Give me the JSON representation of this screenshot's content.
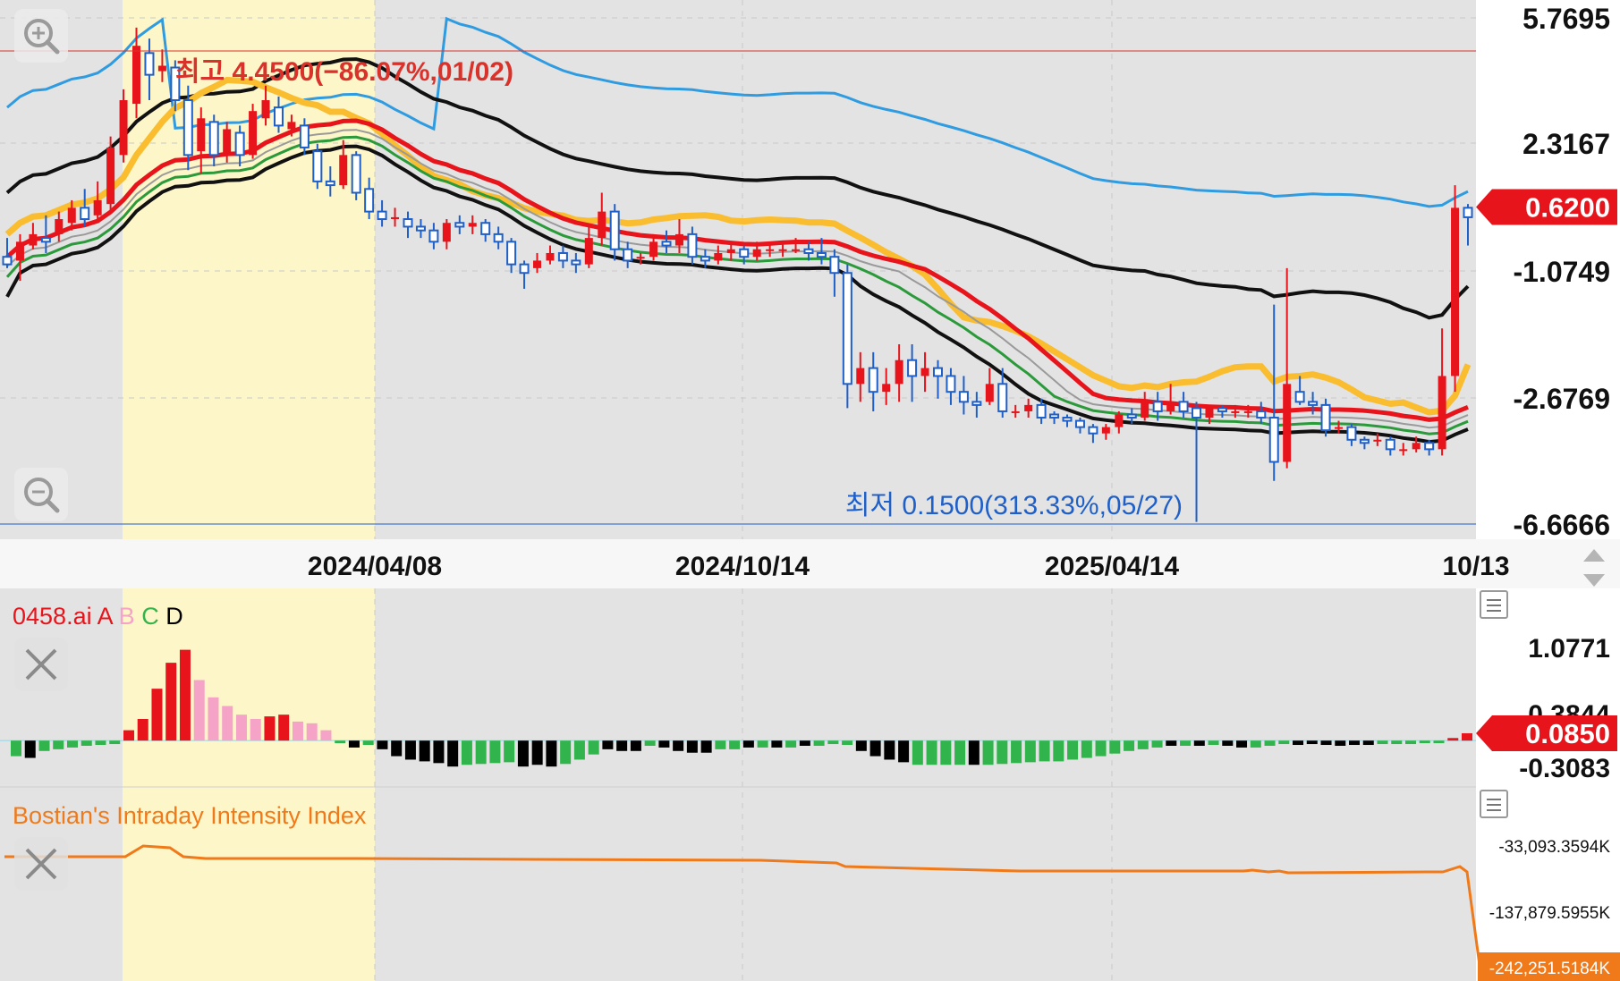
{
  "chart_data": [
    {
      "type": "candlestick",
      "title": "",
      "y_axis": {
        "ticks": [
          "5.7695",
          "2.3167",
          "-1.0749",
          "-2.6769",
          "-6.6666"
        ],
        "ylim": [
          -6.6666,
          5.7695
        ]
      },
      "x_axis": {
        "ticks": [
          "2024/04/08",
          "2024/10/14",
          "2025/04/14",
          "10/13"
        ]
      },
      "current_price": "0.6200",
      "highest_label": "최고 4.4500(−86.07%,01/02)",
      "lowest_label": "최저 0.1500(313.33%,05/27)",
      "highlight_band": "2024-01 to 2024-04",
      "ohlc": [
        [
          -0.7,
          -0.9,
          -0.2,
          -1.0
        ],
        [
          -0.8,
          -0.3,
          -0.1,
          -1.2
        ],
        [
          -0.4,
          -0.1,
          0.2,
          -0.5
        ],
        [
          -0.2,
          -0.3,
          0.4,
          -0.6
        ],
        [
          -0.1,
          0.3,
          0.5,
          -0.3
        ],
        [
          0.2,
          0.6,
          0.8,
          0.0
        ],
        [
          0.6,
          0.3,
          1.1,
          0.1
        ],
        [
          0.4,
          0.8,
          1.3,
          0.2
        ],
        [
          0.7,
          2.2,
          2.5,
          0.5
        ],
        [
          2.0,
          3.5,
          3.8,
          1.8
        ],
        [
          3.4,
          5.0,
          5.5,
          3.0
        ],
        [
          4.8,
          4.2,
          5.2,
          3.5
        ],
        [
          4.3,
          4.45,
          4.9,
          4.0
        ],
        [
          4.4,
          3.5,
          4.6,
          3.2
        ],
        [
          3.5,
          2.0,
          3.9,
          1.6
        ],
        [
          2.1,
          3.0,
          3.3,
          1.5
        ],
        [
          2.9,
          2.0,
          3.1,
          1.7
        ],
        [
          2.0,
          2.7,
          2.9,
          1.8
        ],
        [
          2.6,
          2.0,
          2.8,
          1.7
        ],
        [
          2.0,
          3.2,
          3.4,
          1.9
        ],
        [
          3.0,
          3.5,
          3.9,
          2.8
        ],
        [
          3.3,
          2.8,
          3.6,
          2.6
        ],
        [
          2.7,
          2.9,
          3.1,
          2.5
        ],
        [
          2.8,
          2.2,
          3.0,
          2.0
        ],
        [
          2.1,
          1.3,
          2.3,
          1.1
        ],
        [
          1.3,
          1.2,
          1.7,
          0.9
        ],
        [
          1.2,
          2.0,
          2.4,
          1.1
        ],
        [
          2.0,
          1.0,
          2.1,
          0.8
        ],
        [
          1.1,
          0.5,
          1.4,
          0.3
        ],
        [
          0.5,
          0.3,
          0.8,
          0.1
        ],
        [
          0.3,
          0.35,
          0.6,
          0.1
        ],
        [
          0.3,
          0.1,
          0.5,
          -0.2
        ],
        [
          0.1,
          0.0,
          0.3,
          -0.2
        ],
        [
          0.0,
          -0.3,
          0.2,
          -0.5
        ],
        [
          -0.3,
          0.2,
          0.3,
          -0.5
        ],
        [
          0.2,
          0.1,
          0.4,
          -0.1
        ],
        [
          0.1,
          0.2,
          0.4,
          -0.1
        ],
        [
          0.2,
          -0.1,
          0.3,
          -0.3
        ],
        [
          -0.1,
          -0.3,
          0.1,
          -0.5
        ],
        [
          -0.3,
          -0.9,
          -0.2,
          -1.1
        ],
        [
          -0.9,
          -1.1,
          -0.8,
          -1.3
        ],
        [
          -1.0,
          -0.8,
          -0.6,
          -1.1
        ],
        [
          -0.8,
          -0.6,
          -0.4,
          -0.9
        ],
        [
          -0.6,
          -0.8,
          -0.4,
          -1.0
        ],
        [
          -0.8,
          -0.9,
          -0.6,
          -1.1
        ],
        [
          -0.9,
          -0.2,
          0.1,
          -1.0
        ],
        [
          -0.2,
          0.5,
          1.0,
          -0.4
        ],
        [
          0.5,
          -0.5,
          0.7,
          -0.8
        ],
        [
          -0.5,
          -0.8,
          -0.3,
          -1.0
        ],
        [
          -0.7,
          -0.7,
          -0.6,
          -0.9
        ],
        [
          -0.7,
          -0.3,
          -0.1,
          -0.8
        ],
        [
          -0.3,
          -0.4,
          0.0,
          -0.6
        ],
        [
          -0.4,
          -0.1,
          0.3,
          -0.6
        ],
        [
          -0.1,
          -0.7,
          0.1,
          -0.9
        ],
        [
          -0.7,
          -0.8,
          -0.5,
          -1.0
        ],
        [
          -0.8,
          -0.6,
          -0.4,
          -0.9
        ],
        [
          -0.6,
          -0.5,
          -0.3,
          -0.8
        ],
        [
          -0.5,
          -0.7,
          -0.4,
          -0.9
        ],
        [
          -0.7,
          -0.5,
          -0.3,
          -0.8
        ],
        [
          -0.5,
          -0.5,
          -0.3,
          -0.7
        ],
        [
          -0.5,
          -0.5,
          -0.3,
          -0.7
        ],
        [
          -0.5,
          -0.5,
          -0.2,
          -0.6
        ],
        [
          -0.5,
          -0.6,
          -0.3,
          -0.8
        ],
        [
          -0.6,
          -0.7,
          -0.2,
          -0.9
        ],
        [
          -0.7,
          -1.1,
          -0.5,
          -1.4
        ],
        [
          -1.1,
          -2.5,
          -0.9,
          -3.0
        ],
        [
          -2.5,
          -2.3,
          -2.1,
          -2.8
        ],
        [
          -2.3,
          -2.6,
          -2.1,
          -3.1
        ],
        [
          -2.6,
          -2.5,
          -2.3,
          -2.9
        ],
        [
          -2.5,
          -2.2,
          -2.0,
          -2.8
        ],
        [
          -2.2,
          -2.4,
          -2.0,
          -2.8
        ],
        [
          -2.4,
          -2.3,
          -2.1,
          -2.6
        ],
        [
          -2.3,
          -2.4,
          -2.2,
          -2.7
        ],
        [
          -2.4,
          -2.6,
          -2.3,
          -2.9
        ],
        [
          -2.6,
          -2.8,
          -2.4,
          -3.2
        ],
        [
          -2.8,
          -2.9,
          -2.6,
          -3.3
        ],
        [
          -2.8,
          -2.5,
          -2.3,
          -2.9
        ],
        [
          -2.5,
          -3.1,
          -2.3,
          -3.3
        ],
        [
          -3.1,
          -3.1,
          -2.9,
          -3.3
        ],
        [
          -3.1,
          -2.9,
          -2.7,
          -3.3
        ],
        [
          -2.9,
          -3.3,
          -2.7,
          -3.5
        ],
        [
          -3.2,
          -3.3,
          -3.1,
          -3.5
        ],
        [
          -3.3,
          -3.4,
          -3.2,
          -3.6
        ],
        [
          -3.4,
          -3.6,
          -3.3,
          -3.8
        ],
        [
          -3.6,
          -3.8,
          -3.5,
          -4.1
        ],
        [
          -3.8,
          -3.6,
          -3.5,
          -4.0
        ],
        [
          -3.6,
          -3.2,
          -3.1,
          -3.8
        ],
        [
          -3.2,
          -3.3,
          -3.0,
          -3.5
        ],
        [
          -3.3,
          -2.8,
          -2.6,
          -3.4
        ],
        [
          -2.8,
          -3.1,
          -2.6,
          -3.4
        ],
        [
          -3.1,
          -2.9,
          -2.5,
          -3.2
        ],
        [
          -2.8,
          -3.1,
          -2.6,
          -3.3
        ],
        [
          -3.0,
          -3.3,
          -2.8,
          -6.6
        ],
        [
          -3.3,
          -3.0,
          -2.9,
          -3.5
        ],
        [
          -3.0,
          -3.1,
          -2.9,
          -3.3
        ],
        [
          -3.1,
          -3.1,
          -2.9,
          -3.3
        ],
        [
          -3.1,
          -3.1,
          -2.9,
          -3.3
        ],
        [
          -3.1,
          -3.3,
          -2.8,
          -3.5
        ],
        [
          -3.3,
          -4.7,
          -1.5,
          -5.3
        ],
        [
          -4.7,
          -2.5,
          -1.0,
          -4.9
        ],
        [
          -2.6,
          -2.8,
          -2.4,
          -2.9
        ],
        [
          -2.8,
          -2.9,
          -2.6,
          -3.2
        ],
        [
          -2.9,
          -3.7,
          -2.7,
          -3.9
        ],
        [
          -3.6,
          -3.6,
          -3.4,
          -3.8
        ],
        [
          -3.6,
          -4.0,
          -3.5,
          -4.2
        ],
        [
          -4.0,
          -4.1,
          -3.9,
          -4.3
        ],
        [
          -4.0,
          -4.0,
          -3.8,
          -4.2
        ],
        [
          -4.0,
          -4.3,
          -3.9,
          -4.5
        ],
        [
          -4.3,
          -4.3,
          -4.1,
          -4.5
        ],
        [
          -4.3,
          -4.1,
          -3.9,
          -4.4
        ],
        [
          -4.1,
          -4.3,
          -4.0,
          -4.5
        ],
        [
          -4.3,
          -2.4,
          -1.8,
          -4.5
        ],
        [
          -2.4,
          0.6,
          1.2,
          -2.6
        ],
        [
          0.6,
          0.35,
          0.7,
          -0.4
        ]
      ]
    },
    {
      "type": "bar",
      "title": "",
      "y_axis": {
        "ticks": [
          "1.0771",
          "0.3844",
          "-0.3083"
        ]
      },
      "current_value": "0.0850",
      "colors": {
        "A": "#e8141b",
        "B": "#f5a3c7",
        "C": "#31b44b",
        "D": "#000000"
      },
      "values": [
        [
          -0.18,
          "C"
        ],
        [
          -0.2,
          "D"
        ],
        [
          -0.12,
          "C"
        ],
        [
          -0.1,
          "C"
        ],
        [
          -0.08,
          "C"
        ],
        [
          -0.06,
          "C"
        ],
        [
          -0.05,
          "C"
        ],
        [
          -0.04,
          "C"
        ],
        [
          0.12,
          "A"
        ],
        [
          0.25,
          "A"
        ],
        [
          0.6,
          "A"
        ],
        [
          0.9,
          "A"
        ],
        [
          1.05,
          "A"
        ],
        [
          0.7,
          "B"
        ],
        [
          0.5,
          "B"
        ],
        [
          0.4,
          "B"
        ],
        [
          0.3,
          "B"
        ],
        [
          0.25,
          "B"
        ],
        [
          0.28,
          "A"
        ],
        [
          0.3,
          "A"
        ],
        [
          0.22,
          "B"
        ],
        [
          0.2,
          "B"
        ],
        [
          0.12,
          "B"
        ],
        [
          -0.03,
          "C"
        ],
        [
          -0.08,
          "D"
        ],
        [
          -0.05,
          "C"
        ],
        [
          -0.1,
          "D"
        ],
        [
          -0.18,
          "D"
        ],
        [
          -0.22,
          "D"
        ],
        [
          -0.24,
          "D"
        ],
        [
          -0.26,
          "D"
        ],
        [
          -0.3,
          "D"
        ],
        [
          -0.28,
          "C"
        ],
        [
          -0.27,
          "C"
        ],
        [
          -0.26,
          "C"
        ],
        [
          -0.25,
          "C"
        ],
        [
          -0.3,
          "D"
        ],
        [
          -0.28,
          "D"
        ],
        [
          -0.3,
          "D"
        ],
        [
          -0.27,
          "C"
        ],
        [
          -0.22,
          "C"
        ],
        [
          -0.16,
          "C"
        ],
        [
          -0.1,
          "D"
        ],
        [
          -0.12,
          "D"
        ],
        [
          -0.12,
          "D"
        ],
        [
          -0.06,
          "C"
        ],
        [
          -0.08,
          "D"
        ],
        [
          -0.12,
          "D"
        ],
        [
          -0.14,
          "D"
        ],
        [
          -0.14,
          "D"
        ],
        [
          -0.1,
          "C"
        ],
        [
          -0.1,
          "C"
        ],
        [
          -0.08,
          "D"
        ],
        [
          -0.08,
          "C"
        ],
        [
          -0.08,
          "D"
        ],
        [
          -0.08,
          "C"
        ],
        [
          -0.06,
          "D"
        ],
        [
          -0.06,
          "C"
        ],
        [
          -0.04,
          "C"
        ],
        [
          -0.05,
          "C"
        ],
        [
          -0.12,
          "D"
        ],
        [
          -0.18,
          "D"
        ],
        [
          -0.22,
          "D"
        ],
        [
          -0.25,
          "D"
        ],
        [
          -0.28,
          "C"
        ],
        [
          -0.28,
          "C"
        ],
        [
          -0.28,
          "C"
        ],
        [
          -0.28,
          "C"
        ],
        [
          -0.28,
          "D"
        ],
        [
          -0.28,
          "C"
        ],
        [
          -0.27,
          "C"
        ],
        [
          -0.26,
          "C"
        ],
        [
          -0.25,
          "C"
        ],
        [
          -0.24,
          "C"
        ],
        [
          -0.24,
          "C"
        ],
        [
          -0.22,
          "C"
        ],
        [
          -0.2,
          "C"
        ],
        [
          -0.18,
          "C"
        ],
        [
          -0.15,
          "C"
        ],
        [
          -0.12,
          "C"
        ],
        [
          -0.1,
          "C"
        ],
        [
          -0.08,
          "C"
        ],
        [
          -0.06,
          "D"
        ],
        [
          -0.06,
          "C"
        ],
        [
          -0.06,
          "D"
        ],
        [
          -0.05,
          "C"
        ],
        [
          -0.06,
          "D"
        ],
        [
          -0.08,
          "D"
        ],
        [
          -0.08,
          "C"
        ],
        [
          -0.06,
          "C"
        ],
        [
          -0.04,
          "C"
        ],
        [
          -0.05,
          "D"
        ],
        [
          -0.04,
          "D"
        ],
        [
          -0.05,
          "D"
        ],
        [
          -0.06,
          "D"
        ],
        [
          -0.05,
          "D"
        ],
        [
          -0.05,
          "D"
        ],
        [
          -0.04,
          "C"
        ],
        [
          -0.04,
          "C"
        ],
        [
          -0.04,
          "C"
        ],
        [
          -0.03,
          "C"
        ],
        [
          -0.03,
          "C"
        ],
        [
          0.03,
          "A"
        ],
        [
          0.085,
          "A"
        ]
      ],
      "legend_prefix": "0458.ai",
      "legend": [
        "A",
        "B",
        "C",
        "D"
      ]
    },
    {
      "type": "line",
      "title": "Bostian's Intraday Intensity Index",
      "y_axis": {
        "ticks": [
          "-33,093.3594K",
          "-137,879.5955K"
        ]
      },
      "current_value": "-242,251.5184K"
    }
  ],
  "colors": {
    "up": "#e8141b",
    "down": "#1f5fc8",
    "upper_band": "#2f9be0",
    "black_band": "#111111",
    "ma_yellow": "#f9bd2f",
    "ma_red": "#e8141b",
    "ma_green": "#2b9a3a",
    "ma_gray": "#9a9a9a",
    "bii_line": "#f07a1a",
    "highlight": "#fdf6c8",
    "plot_bg": "#e3e3e3"
  },
  "icons": {
    "zoom_in": "zoom-in-icon",
    "zoom_out": "zoom-out-icon",
    "close": "close-icon",
    "menu": "menu-icon",
    "scroll": "updown-arrows-icon"
  }
}
